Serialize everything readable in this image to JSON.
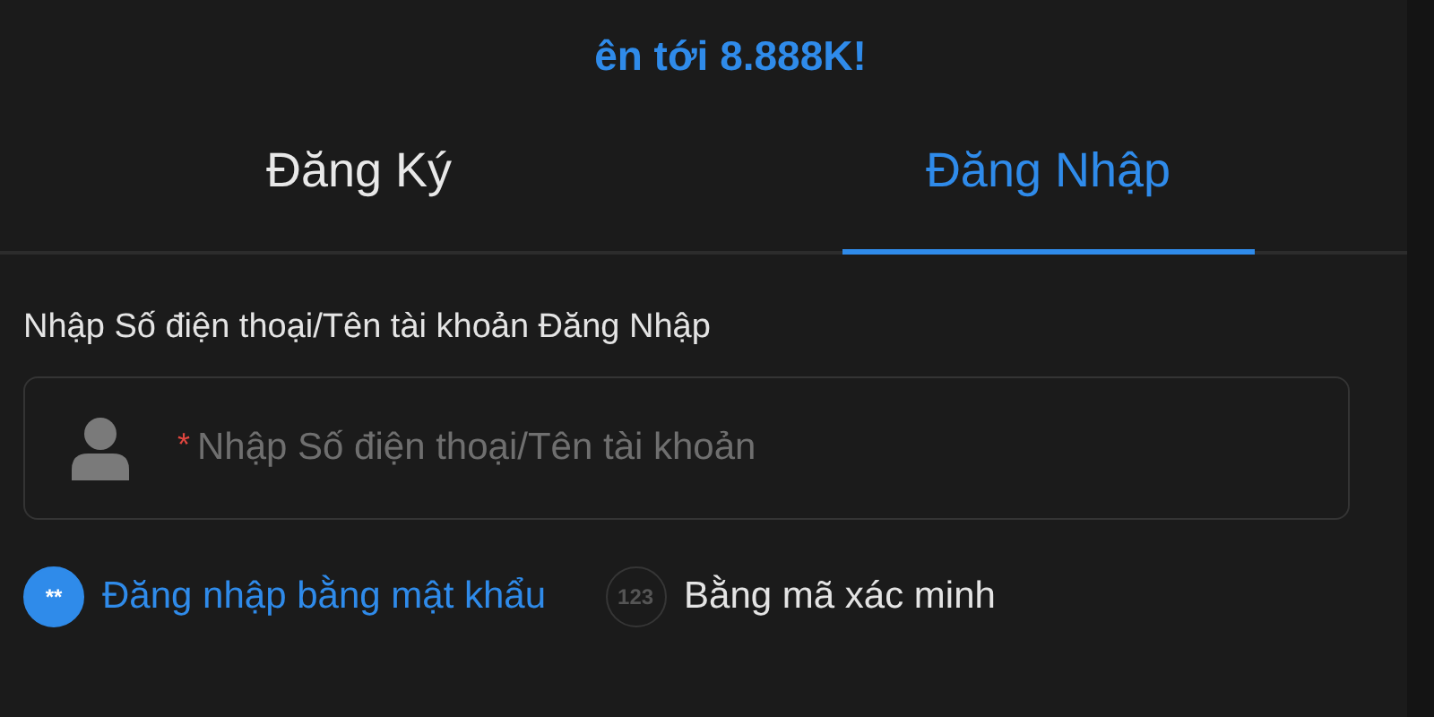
{
  "banner": {
    "text": "ên tới 8.888K!"
  },
  "tabs": [
    {
      "label": "Đăng Ký",
      "selected": false
    },
    {
      "label": "Đăng Nhập",
      "selected": true
    }
  ],
  "form": {
    "label": "Nhập Số điện thoại/Tên tài khoản Đăng Nhập",
    "required_mark": "*",
    "placeholder": "Nhập Số điện thoại/Tên tài khoản"
  },
  "methods": [
    {
      "icon_text": "**",
      "label": "Đăng nhập bằng mật khẩu",
      "selected": true
    },
    {
      "icon_text": "123",
      "label": "Bằng mã xác minh",
      "selected": false
    }
  ]
}
